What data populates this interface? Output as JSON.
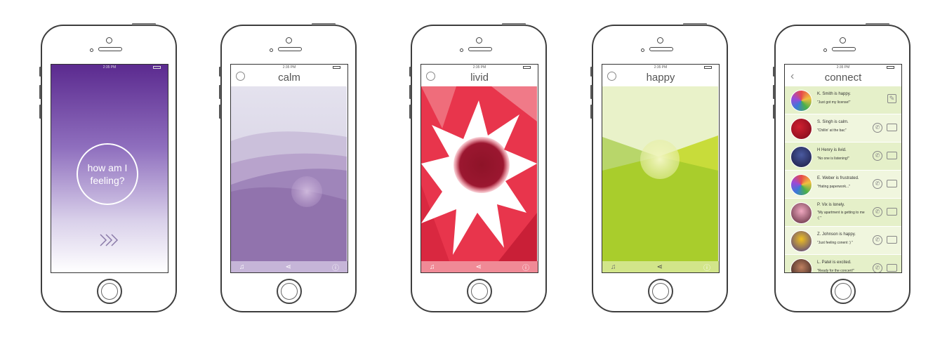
{
  "status_time": "2:35 PM",
  "screens": {
    "intro": {
      "prompt": "how am I feeling?"
    },
    "calm": {
      "title": "calm"
    },
    "livid": {
      "title": "livid"
    },
    "happy": {
      "title": "happy"
    },
    "connect": {
      "title": "connect",
      "items": [
        {
          "status": "K. Smith is happy.",
          "message": "\"Just got my license!\""
        },
        {
          "status": "S. Singh is calm.",
          "message": "\"Chillin' at the bac\""
        },
        {
          "status": "H Henry is livid.",
          "message": "\"No one is listening!\""
        },
        {
          "status": "E. Weber is frustrated.",
          "message": "\"Hating paperwork...\""
        },
        {
          "status": "P. Vix is lonely.",
          "message": "\"My apartment is getting to me :( \""
        },
        {
          "status": "Z. Johnson is happy.",
          "message": "\"Just feeling conent :) \""
        },
        {
          "status": "L. Patel is excited.",
          "message": "\"Ready for the concert!\""
        }
      ]
    }
  },
  "toolbar_icons": [
    "music-icon",
    "share-icon",
    "info-icon"
  ],
  "colors": {
    "intro_top": "#5b2a8f",
    "calm_bottom": "#8c6aa6",
    "livid_red": "#e32c48",
    "happy_green": "#a8cc2a",
    "connect_row": "#e5f0c9"
  }
}
